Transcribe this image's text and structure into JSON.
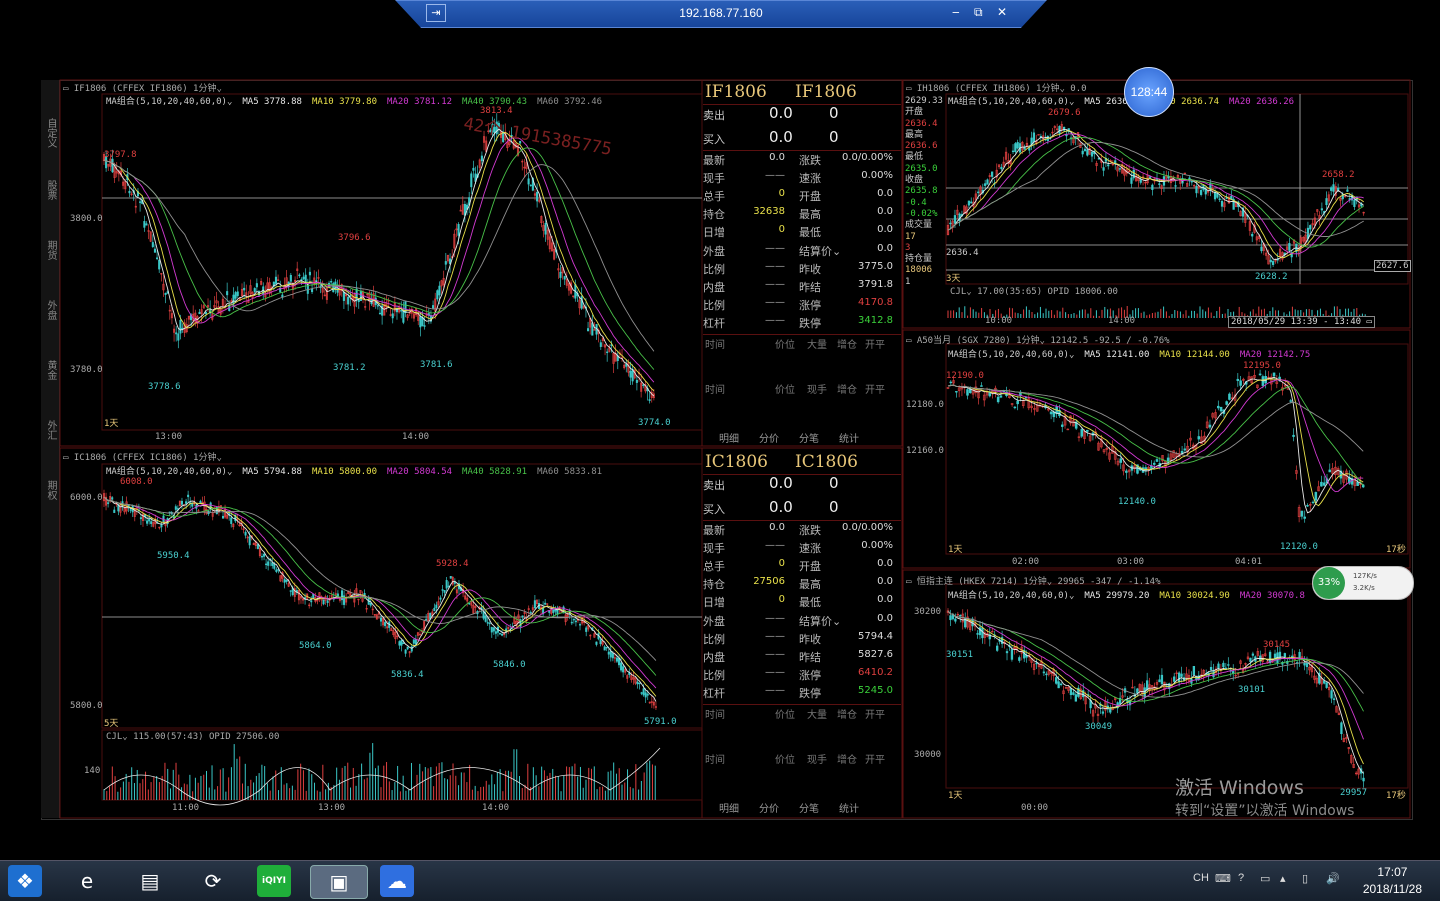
{
  "rdp": {
    "title": "192.168.77.160",
    "min": "‒",
    "restore": "⧉",
    "close": "✕",
    "pin": "⇥"
  },
  "sidebar": [
    "自定义",
    "股票",
    "期货",
    "外盘",
    "黄金",
    "外汇",
    "期权"
  ],
  "panels": {
    "if_chart": {
      "header": "▭ IF1806  (CFFEX IF1806)  1分钟⌄",
      "ma": [
        {
          "t": "MA组合(5,10,20,40,60,0)⌄",
          "c": "#cccccc"
        },
        {
          "t": "MA5 3778.88",
          "c": "#e8e8e8"
        },
        {
          "t": "MA10 3779.80",
          "c": "#e8e04a"
        },
        {
          "t": "MA20 3781.12",
          "c": "#d23ad2"
        },
        {
          "t": "MA40 3790.43",
          "c": "#48c048"
        },
        {
          "t": "MA60 3792.46",
          "c": "#909090"
        }
      ],
      "yticks": [
        "3800.0",
        "3780.0"
      ],
      "xticks": [
        "13:00",
        "14:00"
      ],
      "annotations": [
        {
          "t": "3813.4",
          "c": "#e04040"
        },
        {
          "t": "3796.6",
          "c": "#e04040"
        },
        {
          "t": "3797.8",
          "c": "#e04040"
        },
        {
          "t": "3778.6",
          "c": "#4ad0d0"
        },
        {
          "t": "3781.2",
          "c": "#4ad0d0"
        },
        {
          "t": "3781.6",
          "c": "#4ad0d0"
        },
        {
          "t": "3774.0",
          "c": "#4ad0d0"
        }
      ],
      "period": "1天",
      "watermark": "42个 1915385775"
    },
    "ic_chart": {
      "header": "▭ IC1806  (CFFEX IC1806)  1分钟⌄",
      "ma": [
        {
          "t": "MA组合(5,10,20,40,60,0)⌄",
          "c": "#cccccc"
        },
        {
          "t": "MA5 5794.88",
          "c": "#e8e8e8"
        },
        {
          "t": "MA10 5800.00",
          "c": "#e8e04a"
        },
        {
          "t": "MA20 5804.54",
          "c": "#d23ad2"
        },
        {
          "t": "MA40 5828.91",
          "c": "#48c048"
        },
        {
          "t": "MA60 5833.81",
          "c": "#909090"
        }
      ],
      "yticks": [
        "6000.0",
        "5800.0"
      ],
      "annotations": [
        {
          "t": "6008.0",
          "c": "#e04040"
        },
        {
          "t": "5950.4",
          "c": "#4ad0d0"
        },
        {
          "t": "5928.4",
          "c": "#e04040"
        },
        {
          "t": "5864.0",
          "c": "#4ad0d0"
        },
        {
          "t": "5836.4",
          "c": "#4ad0d0"
        },
        {
          "t": "5846.0",
          "c": "#4ad0d0"
        },
        {
          "t": "5791.0",
          "c": "#4ad0d0"
        }
      ],
      "period": "5天",
      "vol_header": "CJL⌄  115.00(57:43)    OPID  27506.00",
      "vol_tick": "140",
      "xticks": [
        "11:00",
        "13:00",
        "14:00"
      ]
    },
    "ih_chart": {
      "header": "▭ IH1806  (CFFEX IH1806)  1分钟⌄   0.0",
      "ma": [
        {
          "t": "MA组合(5,10,20,40,60,0)⌄",
          "c": "#cccccc"
        },
        {
          "t": "MA5 2636.54",
          "c": "#e8e8e8"
        },
        {
          "t": "MA10 2636.74",
          "c": "#e8e04a"
        },
        {
          "t": "MA20 2636.26",
          "c": "#d23ad2"
        }
      ],
      "left_info": [
        "2629.33",
        "开盘",
        "2636.4",
        "最高",
        "2636.6",
        "最低",
        "2635.0",
        "收盘",
        "2635.8",
        "-0.4",
        "-0.02%",
        "成交量",
        "17",
        "3",
        "持仓量",
        "18006",
        "1"
      ],
      "annotations": [
        {
          "t": "2679.6",
          "c": "#e04040"
        },
        {
          "t": "2658.2",
          "c": "#e04040"
        },
        {
          "t": "2636.4",
          "c": "#cccccc"
        },
        {
          "t": "2628.2",
          "c": "#4ad0d0"
        },
        {
          "t": "2627.6",
          "c": "#cccccc"
        }
      ],
      "period": "3天",
      "vol_header": "CJL⌄  17.00(35:65)    OPID   18006.00",
      "xticks": [
        "10:00",
        "14:00"
      ],
      "cursor_time": "2018/05/29 13:39 - 13:40 ▭",
      "clock": "128:44"
    },
    "a50_chart": {
      "header": "▭ A50当月  (SGX 7280)  1分钟⌄   12142.5  -92.5 / -0.76%",
      "ma": [
        {
          "t": "MA组合(5,10,20,40,60,0)⌄",
          "c": "#cccccc"
        },
        {
          "t": "MA5 12141.00",
          "c": "#e8e8e8"
        },
        {
          "t": "MA10 12144.00",
          "c": "#e8e04a"
        },
        {
          "t": "MA20 12142.75",
          "c": "#d23ad2"
        }
      ],
      "yticks": [
        "12180.0",
        "12160.0"
      ],
      "annotations": [
        {
          "t": "12190.0",
          "c": "#e04040"
        },
        {
          "t": "12195.0",
          "c": "#e04040"
        },
        {
          "t": "12140.0",
          "c": "#4ad0d0"
        },
        {
          "t": "12120.0",
          "c": "#4ad0d0"
        }
      ],
      "period": "1天",
      "xticks": [
        "02:00",
        "03:00",
        "04:01"
      ],
      "right": "17秒"
    },
    "hsi_chart": {
      "header": "▭ 恒指主连  (HKEX 7214)  1分钟⌄   29965  -347 / -1.14%",
      "ma": [
        {
          "t": "MA组合(5,10,20,40,60,0)⌄",
          "c": "#cccccc"
        },
        {
          "t": "MA5 29979.20",
          "c": "#e8e8e8"
        },
        {
          "t": "MA10 30024.90",
          "c": "#e8e04a"
        },
        {
          "t": "MA20 30070.8",
          "c": "#d23ad2"
        }
      ],
      "yticks": [
        "30200",
        "30000"
      ],
      "annotations": [
        {
          "t": "30151",
          "c": "#4ad0d0"
        },
        {
          "t": "30049",
          "c": "#4ad0d0"
        },
        {
          "t": "30145",
          "c": "#e04040"
        },
        {
          "t": "30101",
          "c": "#4ad0d0"
        },
        {
          "t": "29957",
          "c": "#4ad0d0"
        }
      ],
      "period": "1天",
      "xticks": [
        "00:00"
      ],
      "right": "17秒"
    }
  },
  "quotes": [
    {
      "code1": "IF1806",
      "code2": "IF1806",
      "sell": {
        "l": "卖出",
        "p": "0.0",
        "v": "0"
      },
      "buy": {
        "l": "买入",
        "p": "0.0",
        "v": "0"
      },
      "rows": [
        {
          "l1": "最新",
          "v1": "0.0",
          "c1": "#dddddd",
          "l2": "涨跌",
          "v2": "0.0/0.00%",
          "c2": "#dddddd"
        },
        {
          "l1": "现手",
          "v1": "——",
          "c1": "#aaaaaa",
          "l2": "速涨",
          "v2": "0.00%",
          "c2": "#dddddd"
        },
        {
          "l1": "总手",
          "v1": "0",
          "c1": "#e8e04a",
          "l2": "开盘",
          "v2": "0.0",
          "c2": "#dddddd"
        },
        {
          "l1": "持仓",
          "v1": "32638",
          "c1": "#e8e04a",
          "l2": "最高",
          "v2": "0.0",
          "c2": "#dddddd"
        },
        {
          "l1": "日增",
          "v1": "0",
          "c1": "#e8e04a",
          "l2": "最低",
          "v2": "0.0",
          "c2": "#dddddd"
        },
        {
          "l1": "外盘",
          "v1": "——",
          "c1": "#aaaaaa",
          "l2": "结算价⌄",
          "v2": "0.0",
          "c2": "#dddddd"
        },
        {
          "l1": "比例",
          "v1": "——",
          "c1": "#aaaaaa",
          "l2": "昨收",
          "v2": "3775.0",
          "c2": "#dddddd"
        },
        {
          "l1": "内盘",
          "v1": "——",
          "c1": "#aaaaaa",
          "l2": "昨结",
          "v2": "3791.8",
          "c2": "#dddddd"
        },
        {
          "l1": "比例",
          "v1": "——",
          "c1": "#aaaaaa",
          "l2": "涨停",
          "v2": "4170.8",
          "c2": "#e04040"
        },
        {
          "l1": "杠杆",
          "v1": "——",
          "c1": "#aaaaaa",
          "l2": "跌停",
          "v2": "3412.8",
          "c2": "#3ad03a"
        }
      ],
      "ticks_hdr": [
        "时间",
        "价位",
        "大量",
        "增仓",
        "开平"
      ],
      "ticks_hdr2": [
        "时间",
        "价位",
        "现手",
        "增仓",
        "开平"
      ],
      "tabs": [
        "明细",
        "分价",
        "分笔",
        "统计"
      ]
    },
    {
      "code1": "IC1806",
      "code2": "IC1806",
      "sell": {
        "l": "卖出",
        "p": "0.0",
        "v": "0"
      },
      "buy": {
        "l": "买入",
        "p": "0.0",
        "v": "0"
      },
      "rows": [
        {
          "l1": "最新",
          "v1": "0.0",
          "c1": "#dddddd",
          "l2": "涨跌",
          "v2": "0.0/0.00%",
          "c2": "#dddddd"
        },
        {
          "l1": "现手",
          "v1": "——",
          "c1": "#aaaaaa",
          "l2": "速涨",
          "v2": "0.00%",
          "c2": "#dddddd"
        },
        {
          "l1": "总手",
          "v1": "0",
          "c1": "#e8e04a",
          "l2": "开盘",
          "v2": "0.0",
          "c2": "#dddddd"
        },
        {
          "l1": "持仓",
          "v1": "27506",
          "c1": "#e8e04a",
          "l2": "最高",
          "v2": "0.0",
          "c2": "#dddddd"
        },
        {
          "l1": "日增",
          "v1": "0",
          "c1": "#e8e04a",
          "l2": "最低",
          "v2": "0.0",
          "c2": "#dddddd"
        },
        {
          "l1": "外盘",
          "v1": "——",
          "c1": "#aaaaaa",
          "l2": "结算价⌄",
          "v2": "0.0",
          "c2": "#dddddd"
        },
        {
          "l1": "比例",
          "v1": "——",
          "c1": "#aaaaaa",
          "l2": "昨收",
          "v2": "5794.4",
          "c2": "#dddddd"
        },
        {
          "l1": "内盘",
          "v1": "——",
          "c1": "#aaaaaa",
          "l2": "昨结",
          "v2": "5827.6",
          "c2": "#dddddd"
        },
        {
          "l1": "比例",
          "v1": "——",
          "c1": "#aaaaaa",
          "l2": "涨停",
          "v2": "6410.2",
          "c2": "#e04040"
        },
        {
          "l1": "杠杆",
          "v1": "——",
          "c1": "#aaaaaa",
          "l2": "跌停",
          "v2": "5245.0",
          "c2": "#3ad03a"
        }
      ],
      "ticks_hdr": [
        "时间",
        "价位",
        "大量",
        "增仓",
        "开平"
      ],
      "ticks_hdr2": [
        "时间",
        "价位",
        "现手",
        "增仓",
        "开平"
      ],
      "tabs": [
        "明细",
        "分价",
        "分笔",
        "统计"
      ]
    }
  ],
  "watermark": {
    "line1": "激活 Windows",
    "line2": "转到“设置”以激活 Windows"
  },
  "net_widget": {
    "pct": "33%",
    "up": "127K/s",
    "down": "3.2K/s"
  },
  "taskbar": {
    "icons": [
      {
        "name": "start-orb-icon",
        "glyph": "❖",
        "bg": "#1e6fd0"
      },
      {
        "name": "ie-icon",
        "glyph": "e",
        "bg": "transparent"
      },
      {
        "name": "explorer-folder-icon",
        "glyph": "▤",
        "bg": "transparent"
      },
      {
        "name": "green-app-icon",
        "glyph": "⟳",
        "bg": "transparent"
      },
      {
        "name": "iqiyi-icon",
        "glyph": "iQIYI",
        "bg": "#1fae3a"
      },
      {
        "name": "remote-desktop-icon",
        "glyph": "▣",
        "bg": "#5b6b80"
      },
      {
        "name": "baidu-netdisk-icon",
        "glyph": "☁",
        "bg": "#2f6fe0"
      }
    ],
    "tray": [
      "CH",
      "⌨",
      "?",
      "▭",
      "▴",
      "▯",
      "🔊"
    ],
    "time": "17:07",
    "date": "2018/11/28"
  }
}
